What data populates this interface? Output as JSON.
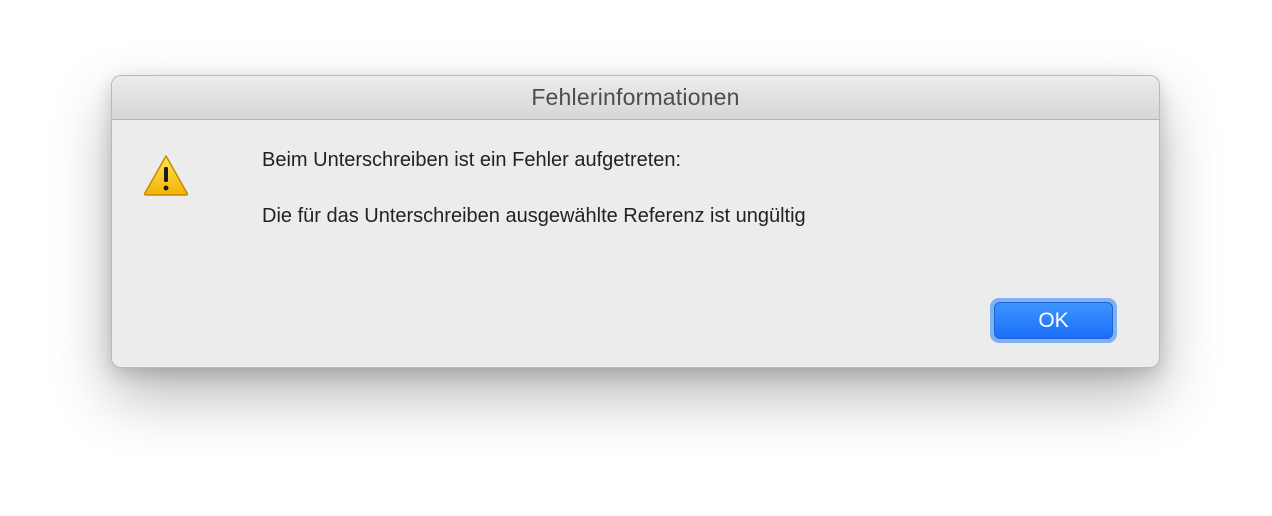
{
  "dialog": {
    "title": "Fehlerinformationen",
    "icon": "warning-icon",
    "message_heading": "Beim Unterschreiben ist ein Fehler aufgetreten:",
    "message_detail": "Die für das Unterschreiben ausgewählte Referenz ist ungültig",
    "ok_label": "OK"
  },
  "colors": {
    "accent": "#1a6ef6",
    "warning_fill": "#f6c000",
    "dialog_bg": "#ececec"
  }
}
